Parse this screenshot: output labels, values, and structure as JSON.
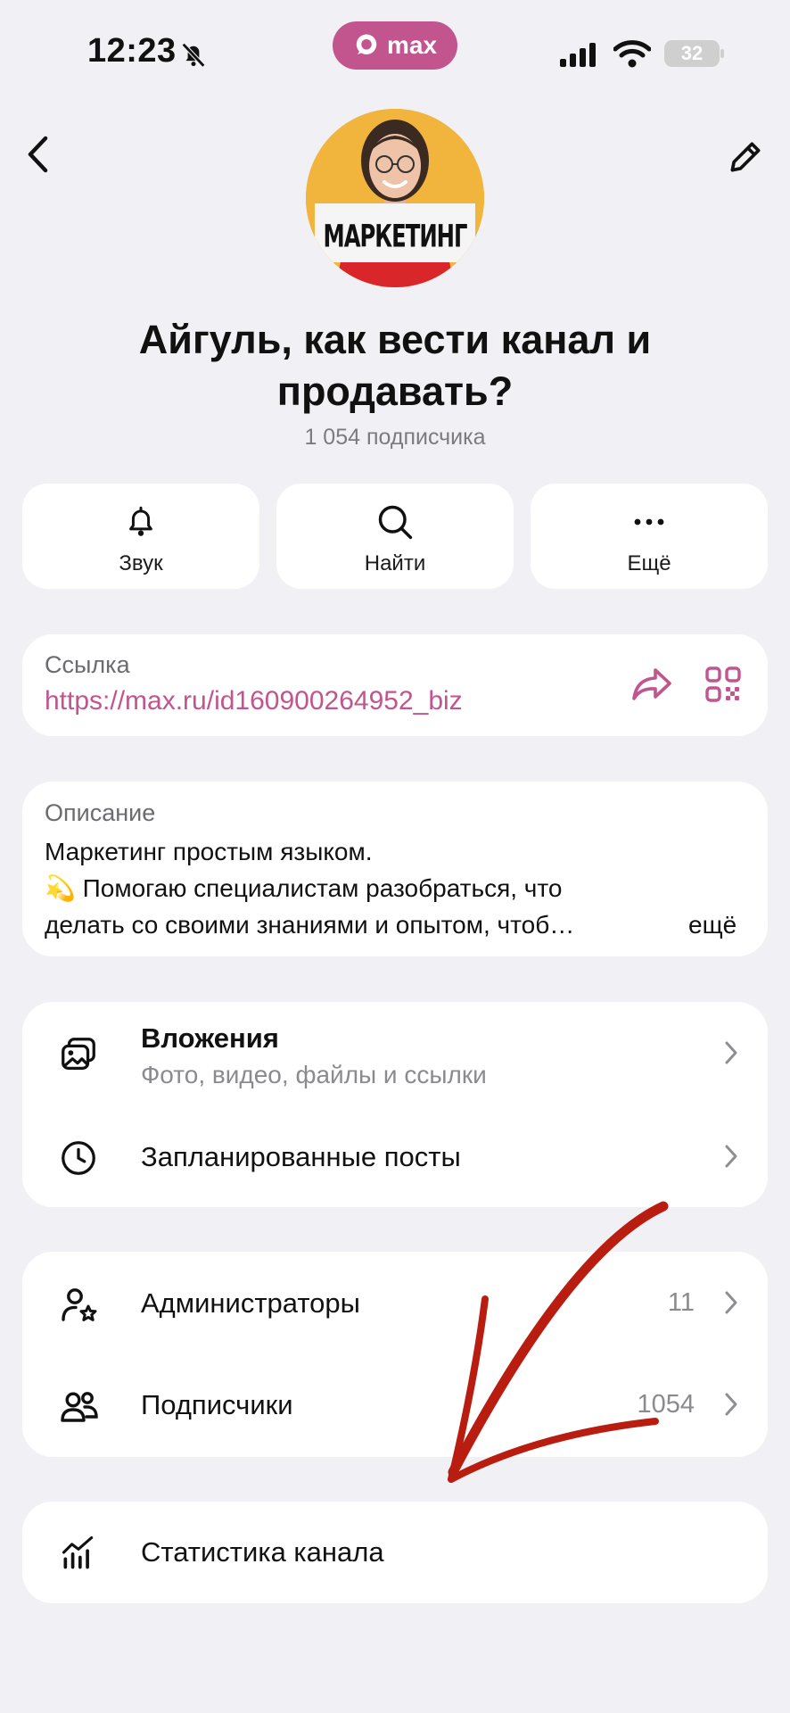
{
  "status_bar": {
    "time": "12:23",
    "app_pill": "max",
    "battery": "32"
  },
  "header": {
    "avatar_sign": "МАРКЕТИНГ",
    "title": "Айгуль, как вести канал и продавать?",
    "subscribers": "1 054 подписчика"
  },
  "actions": [
    {
      "label": "Звук",
      "icon": "bell-icon"
    },
    {
      "label": "Найти",
      "icon": "search-icon"
    },
    {
      "label": "Ещё",
      "icon": "more-icon"
    }
  ],
  "link": {
    "caption": "Ссылка",
    "url": "https://max.ru/id160900264952_biz"
  },
  "description": {
    "caption": "Описание",
    "line1": "Маркетинг простым языком.",
    "line2": "💫 Помогаю специалистам разобраться, что",
    "line3": "делать со своими знаниями и опытом, чтоб…",
    "more": "ещё"
  },
  "menu1": [
    {
      "title": "Вложения",
      "subtitle": "Фото, видео, файлы и ссылки",
      "icon": "gallery-icon"
    },
    {
      "title": "Запланированные посты",
      "icon": "clock-icon"
    }
  ],
  "menu2": [
    {
      "title": "Администраторы",
      "count": "11",
      "icon": "admin-icon"
    },
    {
      "title": "Подписчики",
      "count": "1054",
      "icon": "people-icon"
    }
  ],
  "stats": {
    "title": "Статистика канала",
    "icon": "stats-icon"
  },
  "colors": {
    "accent": "#c2548e",
    "background": "#f1f0f4",
    "annotation_arrow": "#b81d10"
  }
}
